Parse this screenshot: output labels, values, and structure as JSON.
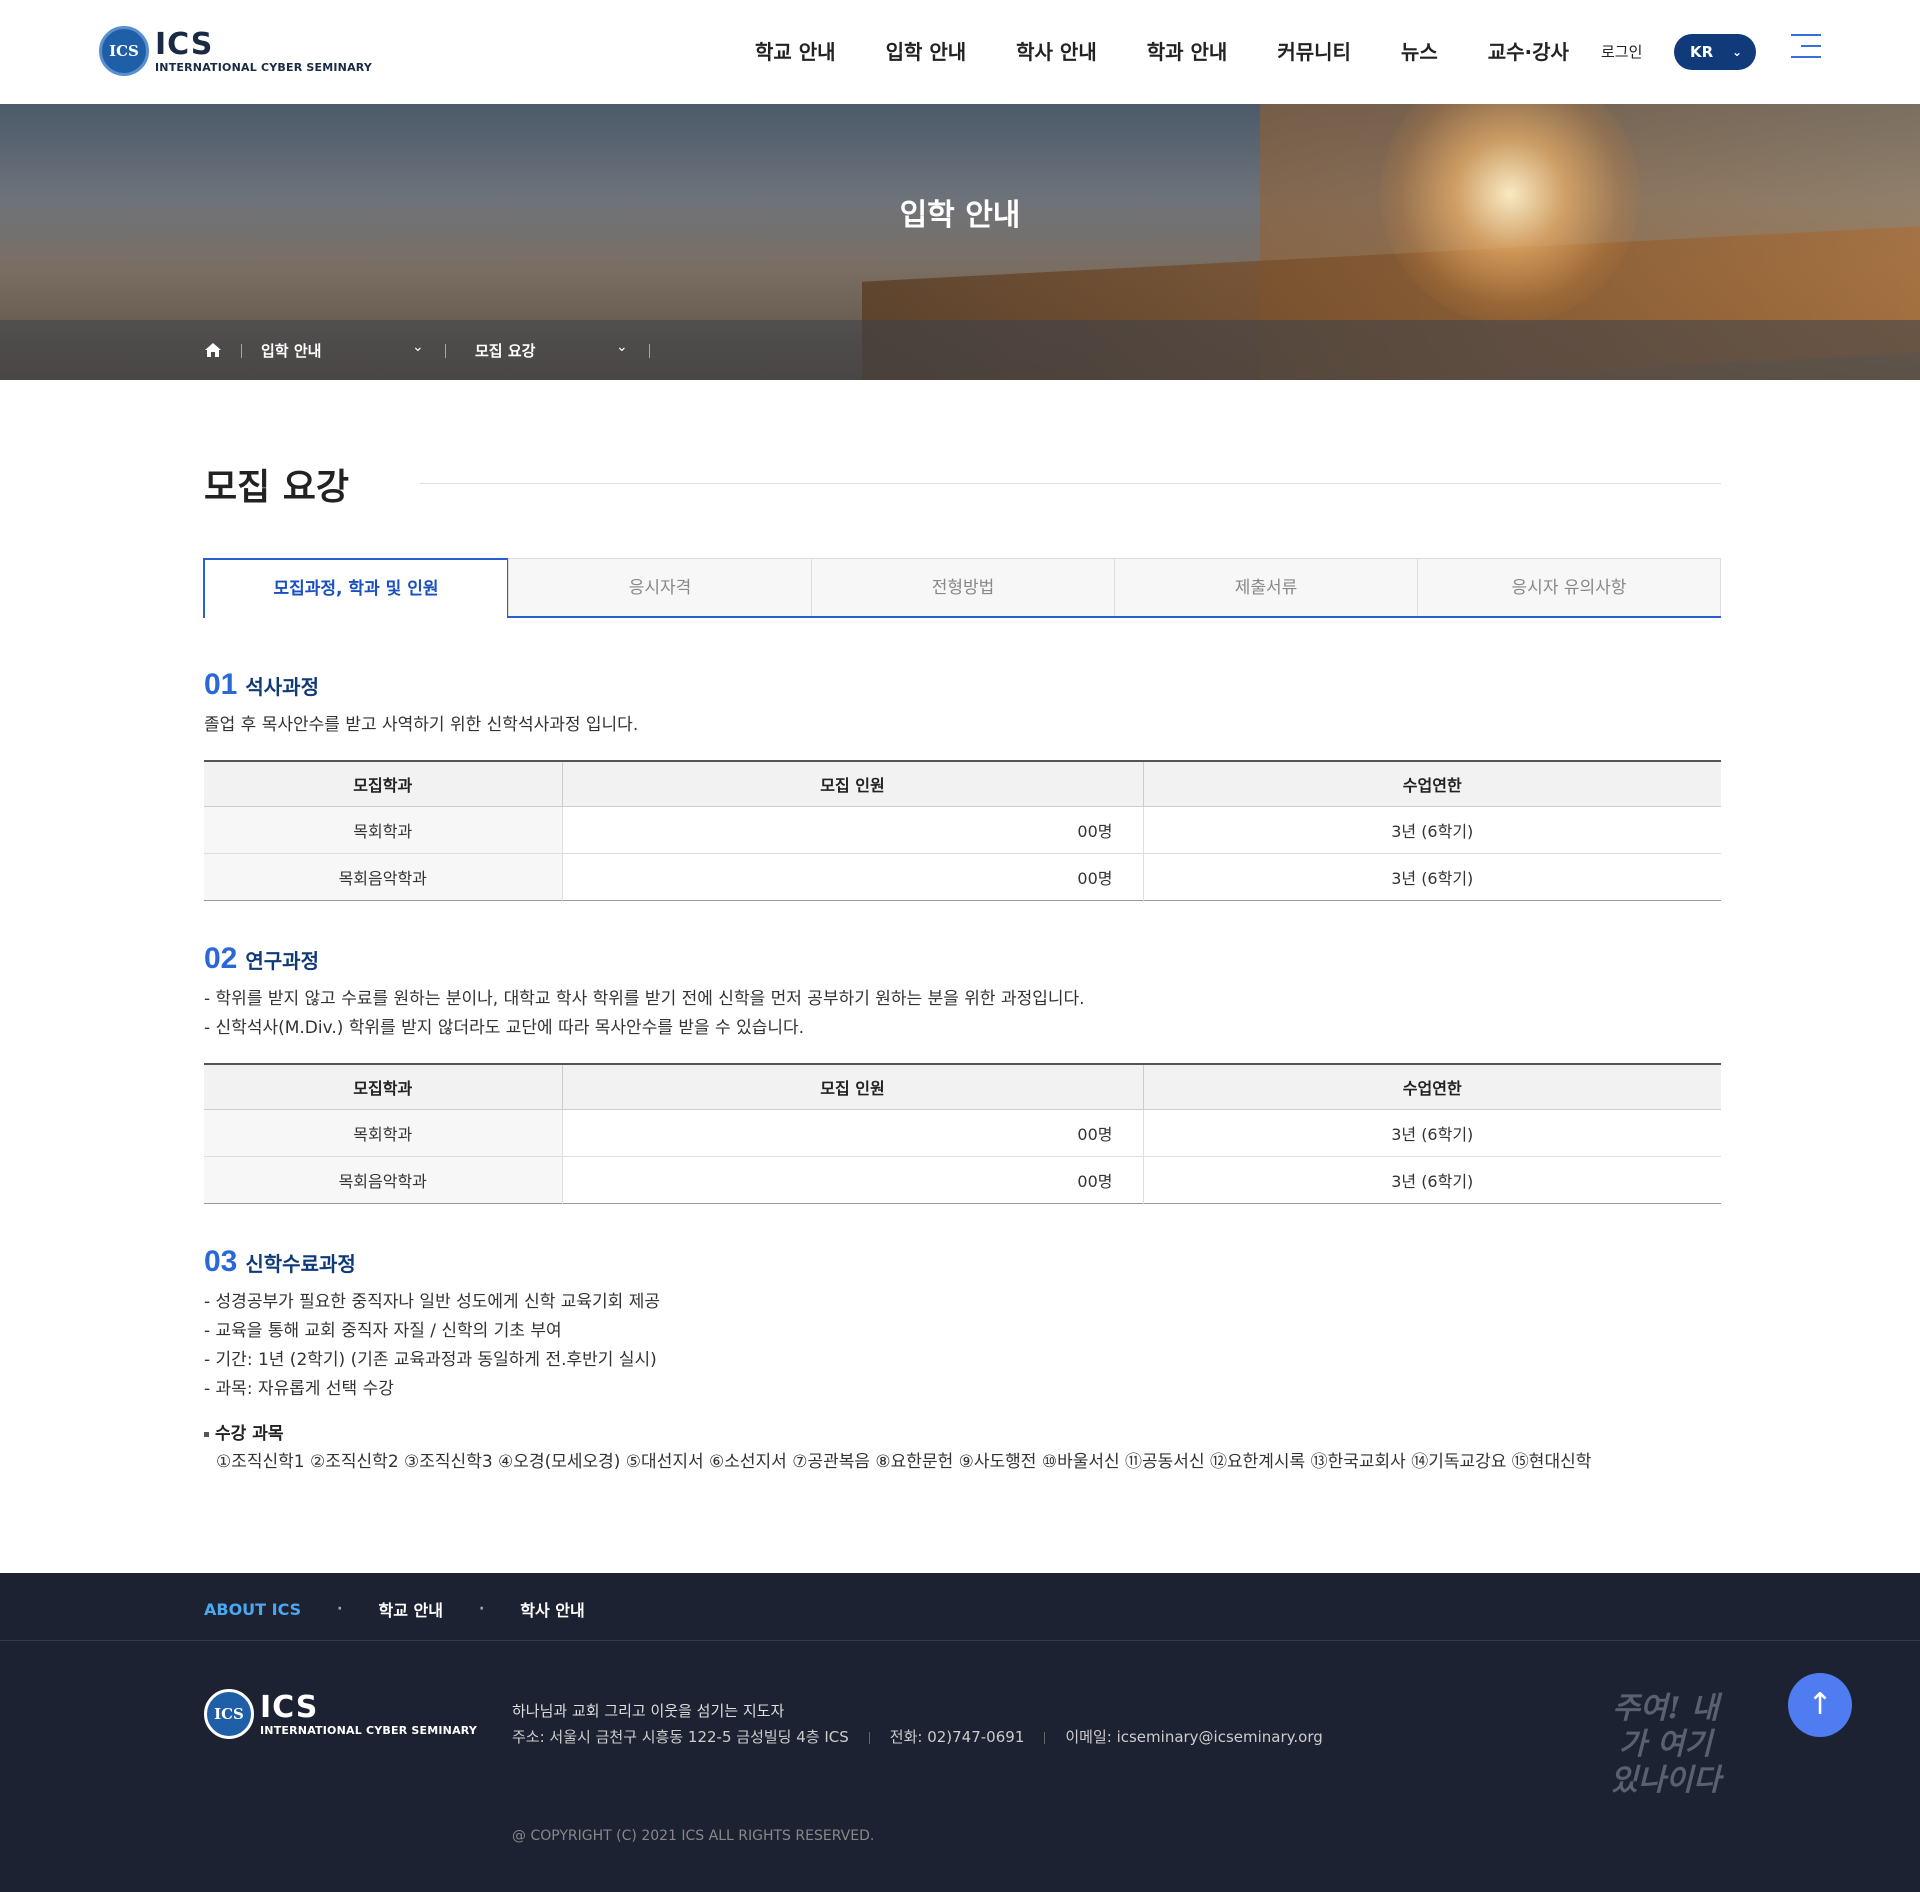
{
  "header": {
    "logo_big": "ICS",
    "logo_small": "INTERNATIONAL CYBER SEMINARY",
    "logo_seal": "ICS",
    "nav": [
      "학교 안내",
      "입학 안내",
      "학사 안내",
      "학과 안내",
      "커뮤니티",
      "뉴스",
      "교수·강사"
    ],
    "login": "로그인",
    "lang": "KR"
  },
  "hero": {
    "title": "입학 안내",
    "location": {
      "depth1": "입학 안내",
      "depth2": "모집 요강"
    }
  },
  "page": {
    "title": "모집 요강",
    "tabs": [
      "모집과정, 학과 및 인원",
      "응시자격",
      "전형방법",
      "제출서류",
      "응시자 유의사항"
    ],
    "active_tab": 0
  },
  "sections": [
    {
      "num": "01",
      "title": "석사과정",
      "desc": [
        "졸업 후 목사안수를 받고 사역하기 위한 신학석사과정 입니다."
      ],
      "table": {
        "headers": [
          "모집학과",
          "모집 인원",
          "수업연한"
        ],
        "rows": [
          [
            "목회학과",
            "00명",
            "3년 (6학기)"
          ],
          [
            "목회음악학과",
            "00명",
            "3년 (6학기)"
          ]
        ]
      }
    },
    {
      "num": "02",
      "title": "연구과정",
      "desc": [
        "- 학위를 받지 않고 수료를 원하는 분이나, 대학교 학사 학위를 받기 전에 신학을 먼저 공부하기 원하는 분을 위한 과정입니다.",
        "- 신학석사(M.Div.) 학위를 받지 않더라도 교단에 따라 목사안수를 받을 수 있습니다."
      ],
      "table": {
        "headers": [
          "모집학과",
          "모집 인원",
          "수업연한"
        ],
        "rows": [
          [
            "목회학과",
            "00명",
            "3년 (6학기)"
          ],
          [
            "목회음악학과",
            "00명",
            "3년 (6학기)"
          ]
        ]
      }
    },
    {
      "num": "03",
      "title": "신학수료과정",
      "desc": [
        "- 성경공부가 필요한 중직자나 일반 성도에게 신학 교육기회 제공",
        "- 교육을 통해 교회 중직자 자질 / 신학의 기초 부여",
        "- 기간: 1년 (2학기) (기존 교육과정과 동일하게 전.후반기 실시)",
        "- 과목: 자유롭게 선택 수강"
      ],
      "subjects_title": "수강 과목",
      "subjects": "①조직신학1 ②조직신학2 ③조직신학3 ④오경(모세오경) ⑤대선지서 ⑥소선지서 ⑦공관복음 ⑧요한문헌 ⑨사도행전 ⑩바울서신 ⑪공동서신 ⑫요한계시록 ⑬한국교회사 ⑭기독교강요 ⑮현대신학"
    }
  ],
  "footer": {
    "nav": [
      "ABOUT ICS",
      "학교 안내",
      "학사 안내"
    ],
    "slogan": "하나님과 교회 그리고 이웃을 섬기는 지도자",
    "address": "주소: 서울시 금천구 시흥동 122-5 금성빌딩 4층 ICS",
    "phone": "전화: 02)747-0691",
    "email": "이메일: icseminary@icseminary.org",
    "copyright": "@ COPYRIGHT (C) 2021 ICS ALL RIGHTS RESERVED.",
    "calligraphy": "주여! 내가 여기 있나이다",
    "top_button": "↑"
  },
  "colors": {
    "primary": "#1a4fc0",
    "navy": "#103a7a",
    "accent_blue": "#2a68d8",
    "footer_bg": "#1d2232",
    "top_button": "#4f7cf0"
  },
  "icons": [
    "home-icon",
    "chevron-down-icon",
    "hamburger-menu-icon",
    "arrow-up-icon"
  ]
}
